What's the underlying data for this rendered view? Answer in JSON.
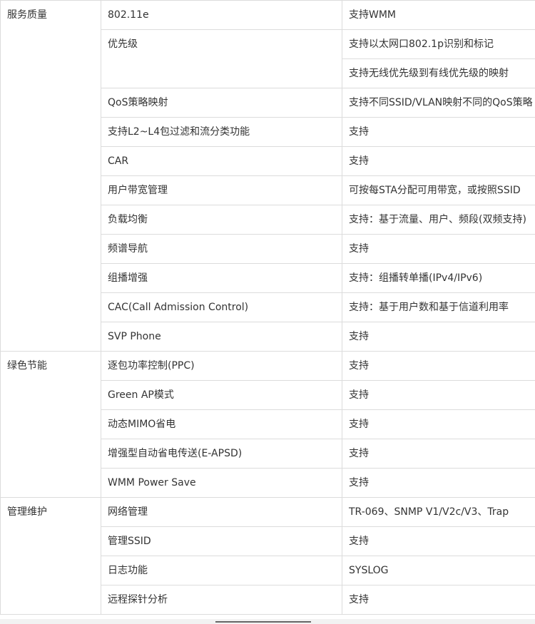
{
  "groups": [
    {
      "category": "服务质量",
      "rows": [
        {
          "feature": "802.11e",
          "support": [
            "支持WMM"
          ]
        },
        {
          "feature": "优先级",
          "support": [
            "支持以太网口802.1p识别和标记",
            "支持无线优先级到有线优先级的映射"
          ]
        },
        {
          "feature": "QoS策略映射",
          "support": [
            "支持不同SSID/VLAN映射不同的QoS策略"
          ]
        },
        {
          "feature": "支持L2~L4包过滤和流分类功能",
          "support": [
            "支持"
          ]
        },
        {
          "feature": "CAR",
          "support": [
            "支持"
          ]
        },
        {
          "feature": "用户带宽管理",
          "support": [
            "可按每STA分配可用带宽，或按照SSID"
          ]
        },
        {
          "feature": "负载均衡",
          "support": [
            "支持：基于流量、用户、频段(双频支持)"
          ]
        },
        {
          "feature": "频谱导航",
          "support": [
            "支持"
          ]
        },
        {
          "feature": "组播增强",
          "support": [
            "支持：组播转单播(IPv4/IPv6)"
          ]
        },
        {
          "feature": "CAC(Call Admission Control)",
          "support": [
            "支持：基于用户数和基于信道利用率"
          ]
        },
        {
          "feature": "SVP Phone",
          "support": [
            "支持"
          ]
        }
      ]
    },
    {
      "category": "绿色节能",
      "rows": [
        {
          "feature": "逐包功率控制(PPC)",
          "support": [
            "支持"
          ]
        },
        {
          "feature": "Green AP模式",
          "support": [
            "支持"
          ]
        },
        {
          "feature": "动态MIMO省电",
          "support": [
            "支持"
          ]
        },
        {
          "feature": "增强型自动省电传送(E-APSD)",
          "support": [
            "支持"
          ]
        },
        {
          "feature": "WMM Power Save",
          "support": [
            "支持"
          ]
        }
      ]
    },
    {
      "category": "管理维护",
      "rows": [
        {
          "feature": "网络管理",
          "support": [
            "TR-069、SNMP V1/V2c/V3、Trap"
          ]
        },
        {
          "feature": "管理SSID",
          "support": [
            "支持"
          ]
        },
        {
          "feature": "日志功能",
          "support": [
            "SYSLOG"
          ]
        },
        {
          "feature": "远程探针分析",
          "support": [
            "支持"
          ]
        }
      ]
    }
  ]
}
